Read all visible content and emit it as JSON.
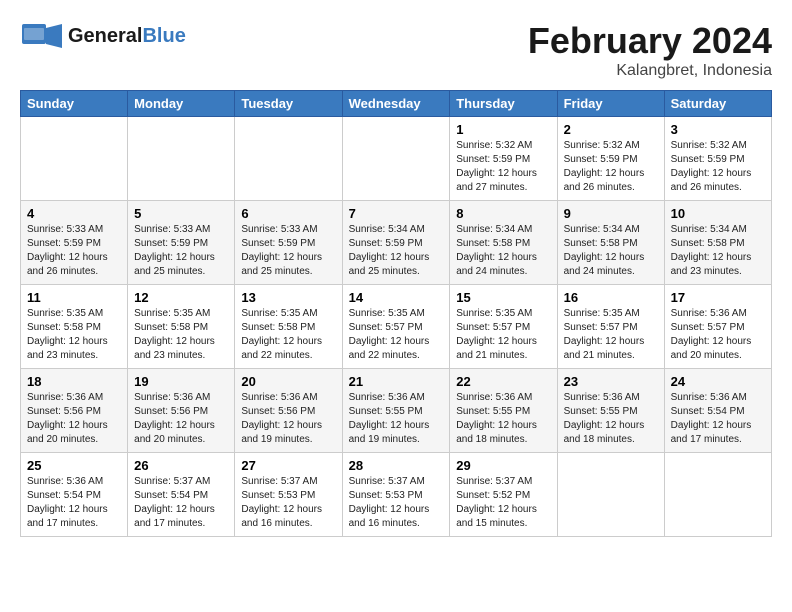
{
  "header": {
    "logo_line1": "General",
    "logo_line2": "Blue",
    "month": "February 2024",
    "location": "Kalangbret, Indonesia"
  },
  "days_of_week": [
    "Sunday",
    "Monday",
    "Tuesday",
    "Wednesday",
    "Thursday",
    "Friday",
    "Saturday"
  ],
  "weeks": [
    [
      {
        "day": "",
        "info": ""
      },
      {
        "day": "",
        "info": ""
      },
      {
        "day": "",
        "info": ""
      },
      {
        "day": "",
        "info": ""
      },
      {
        "day": "1",
        "info": "Sunrise: 5:32 AM\nSunset: 5:59 PM\nDaylight: 12 hours\nand 27 minutes."
      },
      {
        "day": "2",
        "info": "Sunrise: 5:32 AM\nSunset: 5:59 PM\nDaylight: 12 hours\nand 26 minutes."
      },
      {
        "day": "3",
        "info": "Sunrise: 5:32 AM\nSunset: 5:59 PM\nDaylight: 12 hours\nand 26 minutes."
      }
    ],
    [
      {
        "day": "4",
        "info": "Sunrise: 5:33 AM\nSunset: 5:59 PM\nDaylight: 12 hours\nand 26 minutes."
      },
      {
        "day": "5",
        "info": "Sunrise: 5:33 AM\nSunset: 5:59 PM\nDaylight: 12 hours\nand 25 minutes."
      },
      {
        "day": "6",
        "info": "Sunrise: 5:33 AM\nSunset: 5:59 PM\nDaylight: 12 hours\nand 25 minutes."
      },
      {
        "day": "7",
        "info": "Sunrise: 5:34 AM\nSunset: 5:59 PM\nDaylight: 12 hours\nand 25 minutes."
      },
      {
        "day": "8",
        "info": "Sunrise: 5:34 AM\nSunset: 5:58 PM\nDaylight: 12 hours\nand 24 minutes."
      },
      {
        "day": "9",
        "info": "Sunrise: 5:34 AM\nSunset: 5:58 PM\nDaylight: 12 hours\nand 24 minutes."
      },
      {
        "day": "10",
        "info": "Sunrise: 5:34 AM\nSunset: 5:58 PM\nDaylight: 12 hours\nand 23 minutes."
      }
    ],
    [
      {
        "day": "11",
        "info": "Sunrise: 5:35 AM\nSunset: 5:58 PM\nDaylight: 12 hours\nand 23 minutes."
      },
      {
        "day": "12",
        "info": "Sunrise: 5:35 AM\nSunset: 5:58 PM\nDaylight: 12 hours\nand 23 minutes."
      },
      {
        "day": "13",
        "info": "Sunrise: 5:35 AM\nSunset: 5:58 PM\nDaylight: 12 hours\nand 22 minutes."
      },
      {
        "day": "14",
        "info": "Sunrise: 5:35 AM\nSunset: 5:57 PM\nDaylight: 12 hours\nand 22 minutes."
      },
      {
        "day": "15",
        "info": "Sunrise: 5:35 AM\nSunset: 5:57 PM\nDaylight: 12 hours\nand 21 minutes."
      },
      {
        "day": "16",
        "info": "Sunrise: 5:35 AM\nSunset: 5:57 PM\nDaylight: 12 hours\nand 21 minutes."
      },
      {
        "day": "17",
        "info": "Sunrise: 5:36 AM\nSunset: 5:57 PM\nDaylight: 12 hours\nand 20 minutes."
      }
    ],
    [
      {
        "day": "18",
        "info": "Sunrise: 5:36 AM\nSunset: 5:56 PM\nDaylight: 12 hours\nand 20 minutes."
      },
      {
        "day": "19",
        "info": "Sunrise: 5:36 AM\nSunset: 5:56 PM\nDaylight: 12 hours\nand 20 minutes."
      },
      {
        "day": "20",
        "info": "Sunrise: 5:36 AM\nSunset: 5:56 PM\nDaylight: 12 hours\nand 19 minutes."
      },
      {
        "day": "21",
        "info": "Sunrise: 5:36 AM\nSunset: 5:55 PM\nDaylight: 12 hours\nand 19 minutes."
      },
      {
        "day": "22",
        "info": "Sunrise: 5:36 AM\nSunset: 5:55 PM\nDaylight: 12 hours\nand 18 minutes."
      },
      {
        "day": "23",
        "info": "Sunrise: 5:36 AM\nSunset: 5:55 PM\nDaylight: 12 hours\nand 18 minutes."
      },
      {
        "day": "24",
        "info": "Sunrise: 5:36 AM\nSunset: 5:54 PM\nDaylight: 12 hours\nand 17 minutes."
      }
    ],
    [
      {
        "day": "25",
        "info": "Sunrise: 5:36 AM\nSunset: 5:54 PM\nDaylight: 12 hours\nand 17 minutes."
      },
      {
        "day": "26",
        "info": "Sunrise: 5:37 AM\nSunset: 5:54 PM\nDaylight: 12 hours\nand 17 minutes."
      },
      {
        "day": "27",
        "info": "Sunrise: 5:37 AM\nSunset: 5:53 PM\nDaylight: 12 hours\nand 16 minutes."
      },
      {
        "day": "28",
        "info": "Sunrise: 5:37 AM\nSunset: 5:53 PM\nDaylight: 12 hours\nand 16 minutes."
      },
      {
        "day": "29",
        "info": "Sunrise: 5:37 AM\nSunset: 5:52 PM\nDaylight: 12 hours\nand 15 minutes."
      },
      {
        "day": "",
        "info": ""
      },
      {
        "day": "",
        "info": ""
      }
    ]
  ]
}
